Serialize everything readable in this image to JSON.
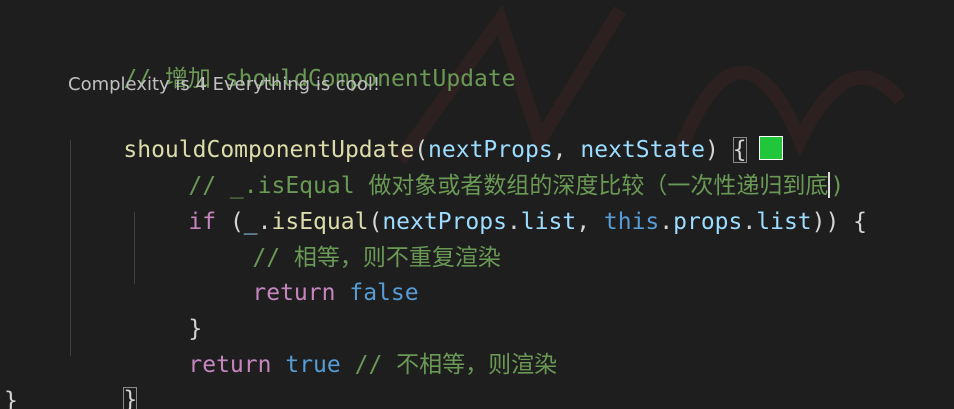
{
  "editor": {
    "colors": {
      "background": "#1e1e1e",
      "comment": "#6a9955",
      "function": "#dcdcaa",
      "parameter": "#9cdcfe",
      "keyword": "#c586c0",
      "constant": "#569cd6",
      "indicator": "#22c63a"
    },
    "comment_line": "// 增加 shouldComponentUpdate",
    "codelens": "Complexity is 4 Everything is cool!",
    "signature": {
      "name": "shouldComponentUpdate",
      "open_paren": "(",
      "param1": "nextProps",
      "comma": ", ",
      "param2": "nextState",
      "close_paren": ") ",
      "open_brace": "{"
    },
    "inner_comment": "// _.isEqual 做对象或者数组的深度比较（一次性递归到底",
    "inner_comment_end": ")",
    "if_line": {
      "keyword": "if",
      "open": " (",
      "lib": "_",
      "dot1": ".",
      "fn": "isEqual",
      "paren": "(",
      "arg1_obj": "nextProps",
      "dot2": ".",
      "arg1_prop": "list",
      "comma": ", ",
      "this_kw": "this",
      "dot3": ".",
      "props": "props",
      "dot4": ".",
      "arg2_prop": "list",
      "close": ")) {"
    },
    "equal_comment": "// 相等，则不重复渲染",
    "return_false": {
      "keyword": "return",
      "value": "false"
    },
    "close_if": "}",
    "return_true": {
      "keyword": "return",
      "value": "true",
      "comment": "// 不相等，则渲染"
    },
    "close_method": "}",
    "close_outer": "}"
  }
}
